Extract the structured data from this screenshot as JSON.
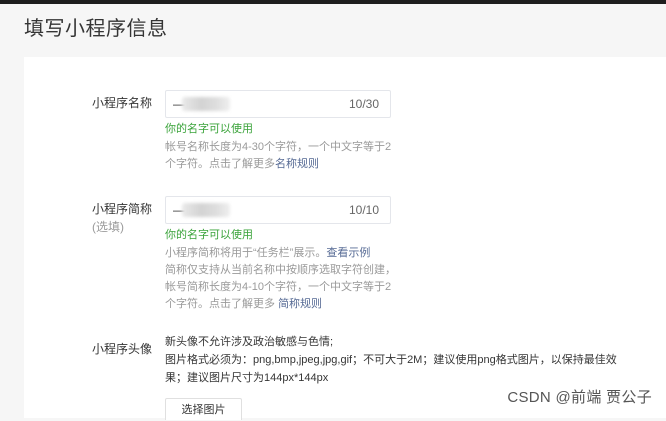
{
  "page": {
    "title": "填写小程序信息"
  },
  "name_field": {
    "label": "小程序名称",
    "value": "—",
    "counter": "10/30",
    "ok_tip": "你的名字可以使用",
    "hint_line1": "帐号名称长度为4-30个字符，一个中文字等于2",
    "hint_line2": "个字符。点击了解更多",
    "hint_link": "名称规则"
  },
  "short_name_field": {
    "label": "小程序简称",
    "sublabel": "(选填)",
    "value": "—",
    "counter": "10/10",
    "ok_tip": "你的名字可以使用",
    "hint_line1": "小程序简称将用于“任务栏”展示。",
    "hint_line1_link": "查看示例",
    "hint_line2": "简称仅支持从当前名称中按顺序选取字符创建，",
    "hint_line3": "帐号简称长度为4-10个字符，一个中文字等于2",
    "hint_line4": "个字符。点击了解更多 ",
    "hint_link": "简称规则"
  },
  "avatar_field": {
    "label": "小程序头像",
    "line1": "新头像不允许涉及政治敏感与色情;",
    "line2": "图片格式必须为：png,bmp,jpeg,jpg,gif；不可大于2M；建议使用png格式图片，以保持最佳效",
    "line3": "果；建议图片尺寸为144px*144px",
    "button": "选择图片"
  },
  "watermark": "CSDN @前端 贾公子",
  "colors": {
    "accent_link": "#576b95",
    "success": "#3aa33a",
    "hint": "#9a9a9a"
  }
}
